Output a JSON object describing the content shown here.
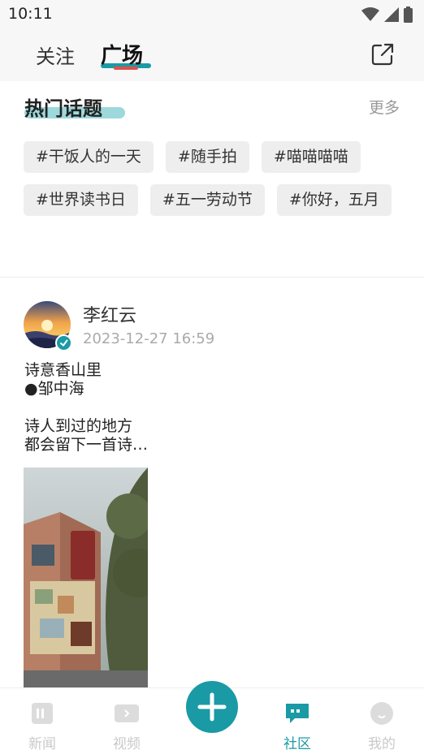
{
  "status_bar": {
    "time": "10:11",
    "icons": [
      "wifi-icon",
      "signal-icon",
      "battery-icon"
    ]
  },
  "top_nav": {
    "tabs": [
      {
        "label": "关注",
        "active": false
      },
      {
        "label": "广场",
        "active": true
      }
    ],
    "share_icon": "share-icon"
  },
  "hot_topics": {
    "title": "热门话题",
    "more_label": "更多",
    "topics": [
      "#干饭人的一天",
      "#随手拍",
      "#喵喵喵喵",
      "#世界读书日",
      "#五一劳动节",
      "#你好，五月"
    ]
  },
  "post": {
    "author": "李红云",
    "timestamp": "2023-12-27 16:59",
    "lines": [
      "诗意香山里",
      "●邹中海",
      "",
      "诗人到过的地方",
      "都会留下一首诗…"
    ]
  },
  "bottom_nav": {
    "items": [
      {
        "label": "新闻",
        "icon": "news-icon",
        "active": false
      },
      {
        "label": "视频",
        "icon": "video-icon",
        "active": false
      },
      {
        "label": "社区",
        "icon": "community-icon",
        "active": true
      },
      {
        "label": "我的",
        "icon": "profile-icon",
        "active": false
      }
    ],
    "fab_icon": "plus-icon"
  },
  "colors": {
    "accent": "#1a9aa5",
    "accent_light": "#9dd9dc",
    "tab_marker": "#e0504a",
    "muted": "#c9c9c9",
    "chip_bg": "#eeeeee"
  }
}
